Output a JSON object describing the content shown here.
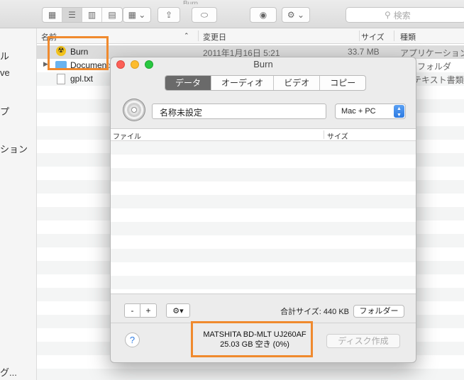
{
  "finder": {
    "toolbar": {
      "search_placeholder": "検索",
      "path_fragment": "Burn"
    },
    "sidebar_items": [
      {
        "label": "ル"
      },
      {
        "label": "ve"
      },
      {
        "label": "プ"
      },
      {
        "label": "ション"
      },
      {
        "label": "グ..."
      }
    ],
    "columns": {
      "name": "名前",
      "date": "変更日",
      "size": "サイズ",
      "kind": "種類"
    },
    "files": [
      {
        "name": "Burn",
        "date": "2011年1月16日 5:21",
        "size": "33.7 MB",
        "kind": "アプリケーション"
      },
      {
        "name": "Documents",
        "date": "",
        "size": "",
        "kind": "フォルダ"
      },
      {
        "name": "gpl.txt",
        "date": "",
        "size": "",
        "kind": "テキスト書類"
      }
    ]
  },
  "burn": {
    "title": "Burn",
    "tabs": [
      {
        "label": "データ",
        "active": true
      },
      {
        "label": "オーディオ"
      },
      {
        "label": "ビデオ"
      },
      {
        "label": "コピー"
      }
    ],
    "disc_name": "名称未設定",
    "filesystem": "Mac + PC",
    "list_columns": {
      "file": "ファイル",
      "size": "サイズ"
    },
    "remove_label": "-",
    "add_label": "+",
    "gear_label": "⚙▾",
    "total_size": "合計サイズ: 440 KB",
    "folder_button": "フォルダー",
    "help_label": "?",
    "drive_name": "MATSHITA BD-MLT UJ260AF",
    "drive_free": "25.03 GB 空き (0%)",
    "burn_button": "ディスク作成"
  },
  "colors": {
    "highlight": "#f08a2e",
    "accent_blue": "#2d7be2"
  }
}
